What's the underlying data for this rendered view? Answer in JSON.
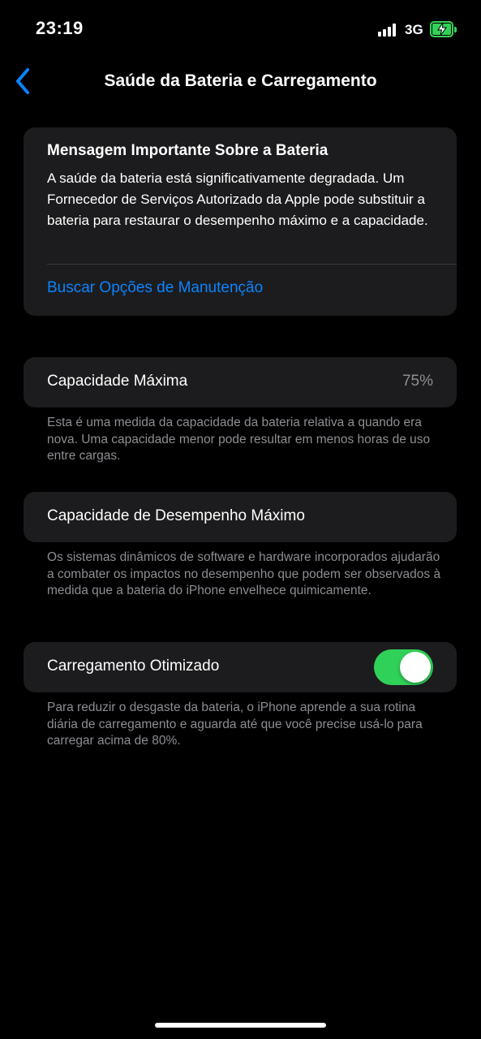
{
  "status_bar": {
    "time": "23:19",
    "network": "3G",
    "battery_charging": true,
    "battery_color": "#32d158"
  },
  "nav": {
    "back_icon": "chevron-left-icon",
    "title": "Saúde da Bateria e Carregamento",
    "accent_color": "#0a84ff"
  },
  "important_message": {
    "title": "Mensagem Importante Sobre a Bateria",
    "body": "A saúde da bateria está significativamente degradada. Um Fornecedor de Serviços Autorizado da Apple pode substituir a bateria para restaurar o desempenho máximo e a capacidade.",
    "link_label": "Buscar Opções de Manutenção"
  },
  "max_capacity": {
    "label": "Capacidade Máxima",
    "value": "75%",
    "footnote": "Esta é uma medida da capacidade da bateria relativa a quando era nova. Uma capacidade menor pode resultar em menos horas de uso entre cargas."
  },
  "peak_performance": {
    "label": "Capacidade de Desempenho Máximo",
    "footnote": "Os sistemas dinâmicos de software e hardware incorporados ajudarão a combater os impactos no desempenho que podem ser observados à medida que a bateria do iPhone envelhece quimicamente."
  },
  "optimized_charging": {
    "label": "Carregamento Otimizado",
    "enabled": true,
    "toggle_color": "#30d158",
    "footnote": "Para reduzir o desgaste da bateria, o iPhone aprende a sua rotina diária de carregamento e aguarda até que você precise usá-lo para carregar acima de 80%."
  }
}
